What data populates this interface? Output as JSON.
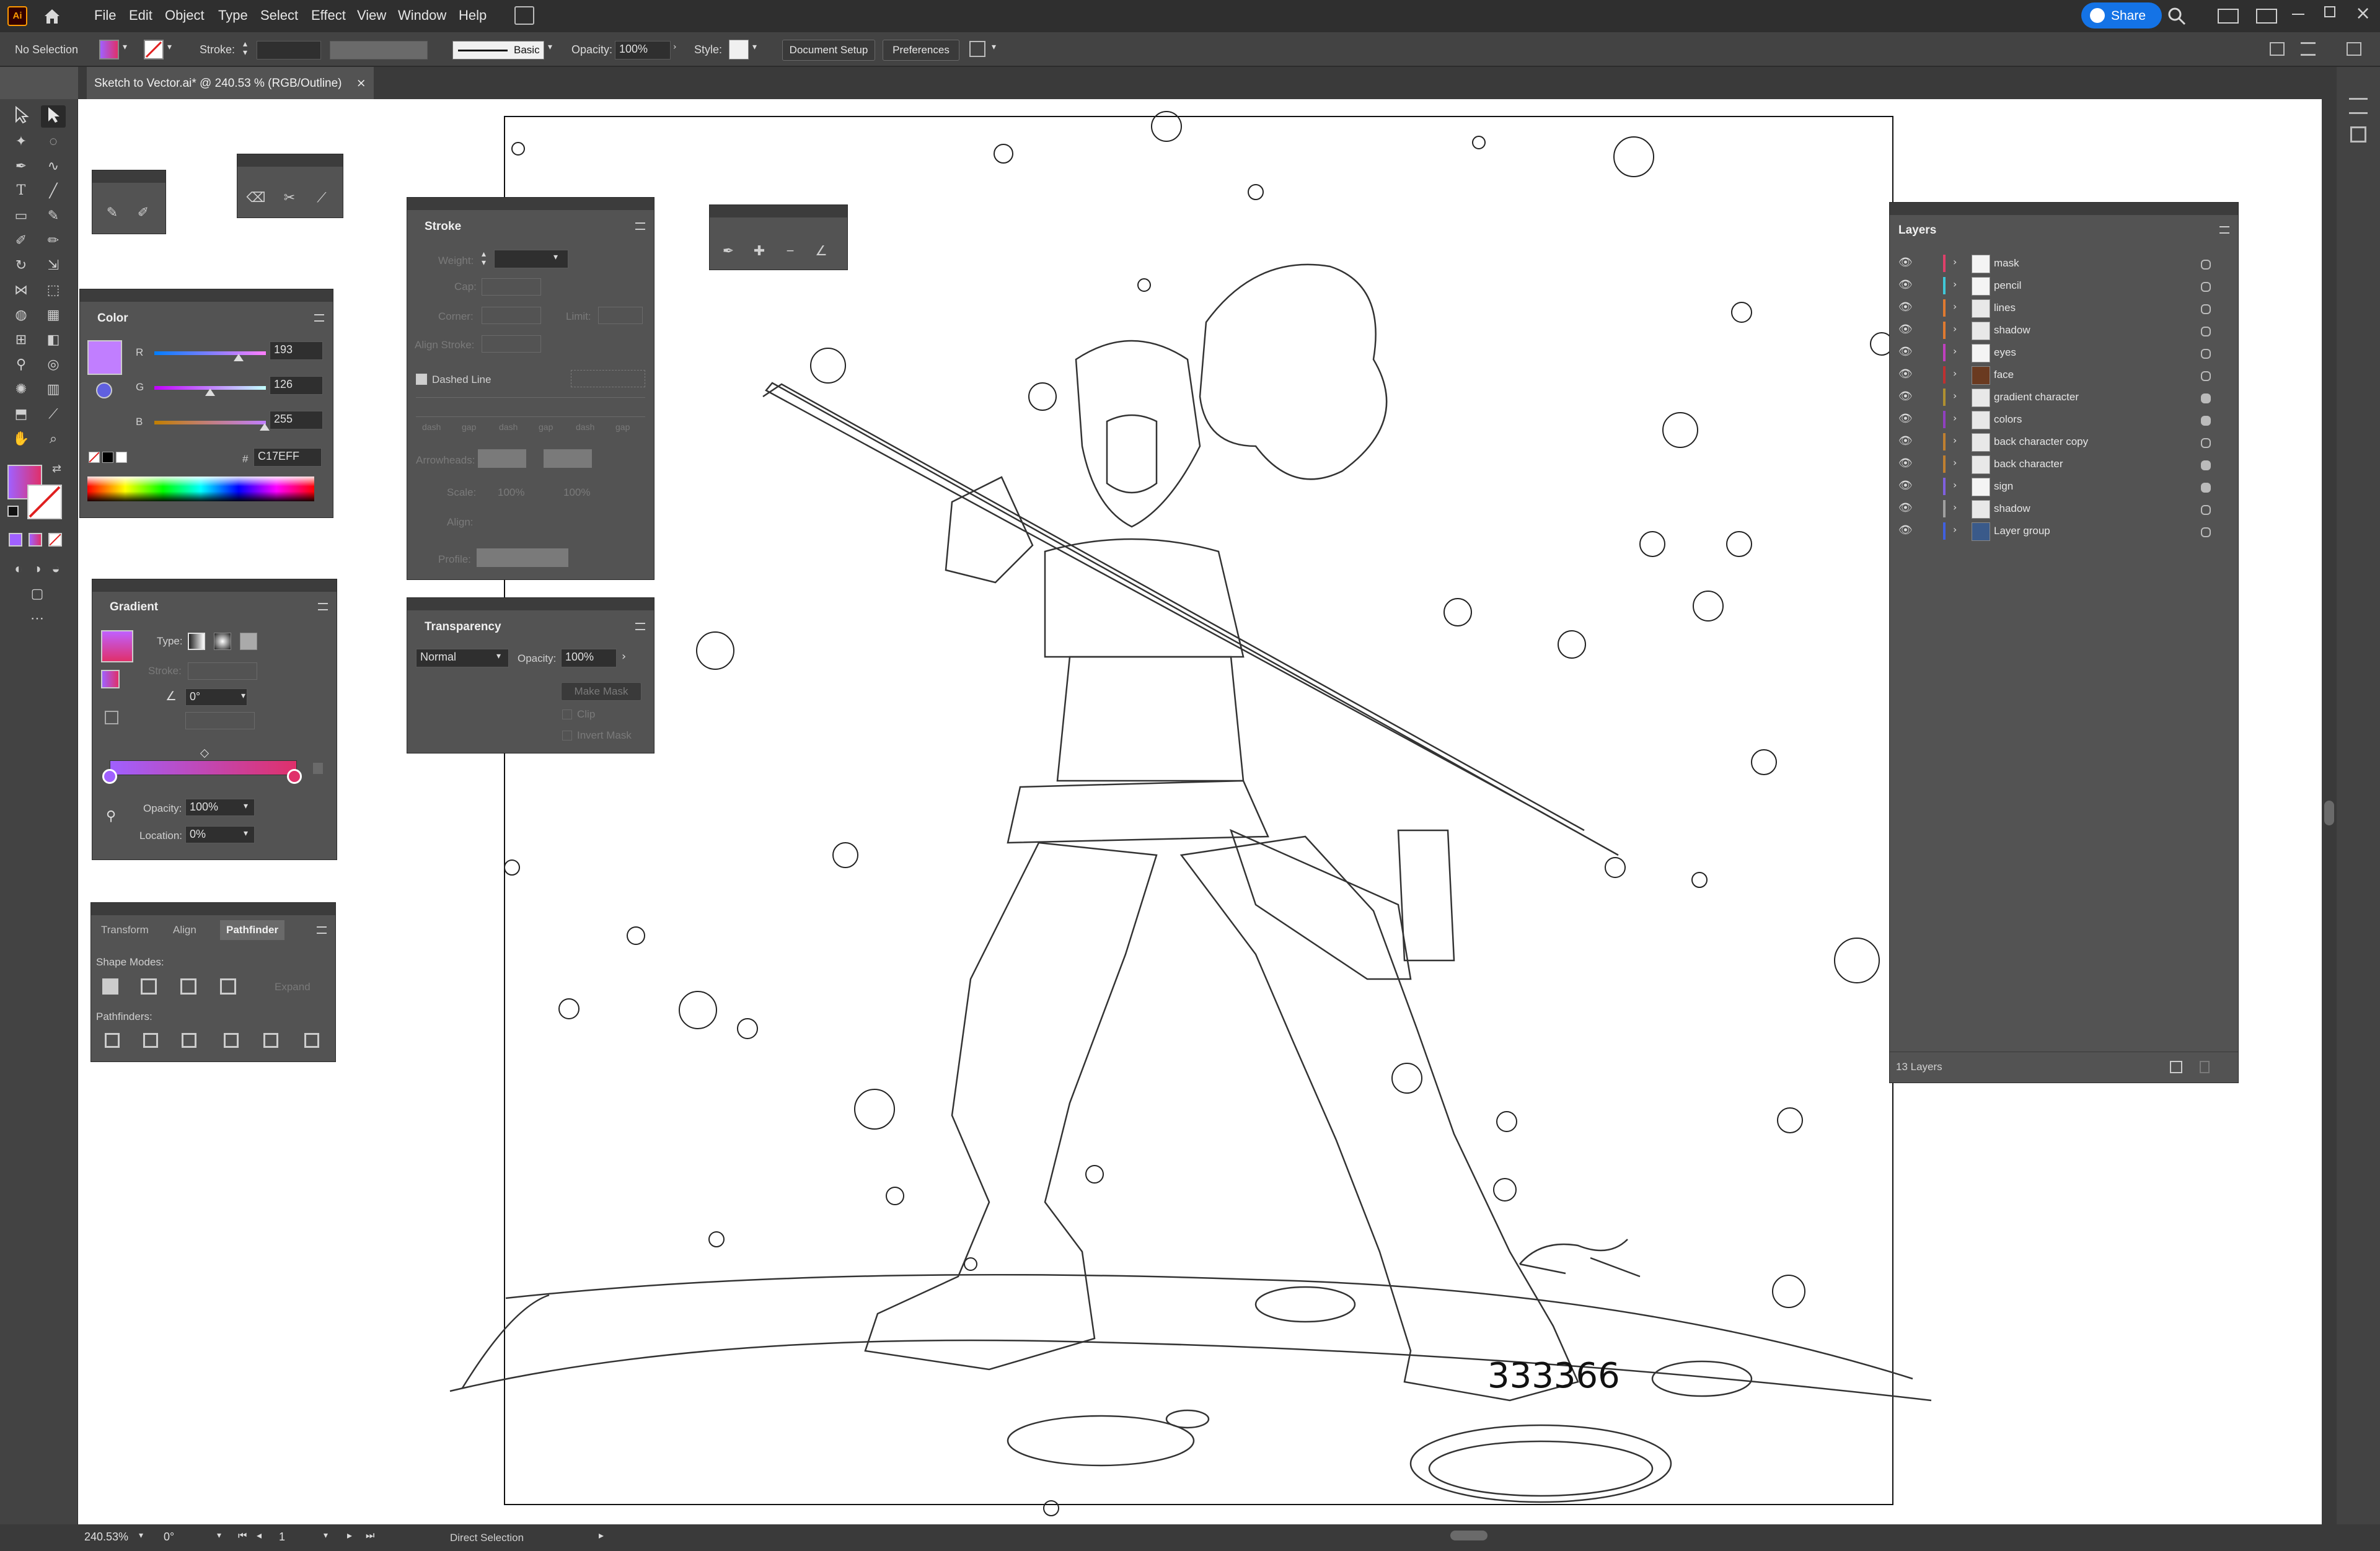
{
  "menubar": {
    "app_logo": "Ai",
    "items": [
      "File",
      "Edit",
      "Object",
      "Type",
      "Select",
      "Effect",
      "View",
      "Window",
      "Help"
    ],
    "share_label": "Share"
  },
  "control_bar": {
    "selection": "No Selection",
    "stroke_label": "Stroke:",
    "brush_label": "Basic",
    "opacity_label": "Opacity:",
    "opacity_value": "100%",
    "style_label": "Style:",
    "document_setup": "Document Setup",
    "preferences": "Preferences"
  },
  "document_tab": {
    "title": "Sketch to Vector.ai* @ 240.53 % (RGB/Outline)",
    "close": "×"
  },
  "color_panel": {
    "title": "Color",
    "r_label": "R",
    "r_value": "193",
    "g_label": "G",
    "g_value": "126",
    "b_label": "B",
    "b_value": "255",
    "hex_prefix": "#",
    "hex_value": "C17EFF",
    "swatch_color": "#C17EFF"
  },
  "gradient_panel": {
    "title": "Gradient",
    "type_label": "Type:",
    "stroke_label": "Stroke:",
    "angle_value": "0°",
    "opacity_label": "Opacity:",
    "opacity_value": "100%",
    "location_label": "Location:",
    "location_value": "0%",
    "stop_left": "#A060FF",
    "stop_right": "#E0306A"
  },
  "transform_panel": {
    "tabs": [
      "Transform",
      "Align",
      "Pathfinder"
    ],
    "active_tab": "Pathfinder",
    "shape_modes_label": "Shape Modes:",
    "expand_label": "Expand",
    "pathfinders_label": "Pathfinders:"
  },
  "stroke_panel": {
    "title": "Stroke",
    "weight_label": "Weight:",
    "cap_label": "Cap:",
    "corner_label": "Corner:",
    "limit_label": "Limit:",
    "align_stroke_label": "Align Stroke:",
    "dashed_line_label": "Dashed Line",
    "dash_gap_labels": [
      "dash",
      "gap",
      "dash",
      "gap",
      "dash",
      "gap"
    ],
    "arrowheads_label": "Arrowheads:",
    "scale_label": "Scale:",
    "scale_value_1": "100%",
    "scale_value_2": "100%",
    "align_label": "Align:",
    "profile_label": "Profile:"
  },
  "transparency_panel": {
    "title": "Transparency",
    "blend_mode": "Normal",
    "opacity_label": "Opacity:",
    "opacity_value": "100%",
    "make_mask": "Make Mask",
    "clip": "Clip",
    "invert_mask": "Invert Mask"
  },
  "layers_panel": {
    "title": "Layers",
    "layers": [
      {
        "name": "mask",
        "color": "#e0406a"
      },
      {
        "name": "pencil",
        "color": "#40c8d8"
      },
      {
        "name": "lines",
        "color": "#e07a30"
      },
      {
        "name": "shadow",
        "color": "#e07a30"
      },
      {
        "name": "eyes",
        "color": "#c040c0"
      },
      {
        "name": "face",
        "color": "#c03030"
      },
      {
        "name": "gradient character",
        "color": "#b09030"
      },
      {
        "name": "colors",
        "color": "#9040c0"
      },
      {
        "name": "back character copy",
        "color": "#c08030"
      },
      {
        "name": "back character",
        "color": "#c08030"
      },
      {
        "name": "sign",
        "color": "#8060e0"
      },
      {
        "name": "shadow",
        "color": "#a0a0a0"
      },
      {
        "name": "Layer group",
        "color": "#4060e0"
      }
    ],
    "footer_count": "13 Layers"
  },
  "canvas": {
    "signature_text": "333366"
  },
  "status_bar": {
    "zoom": "240.53%",
    "rotation": "0°",
    "artboard_number": "1",
    "tool_name": "Direct Selection"
  }
}
